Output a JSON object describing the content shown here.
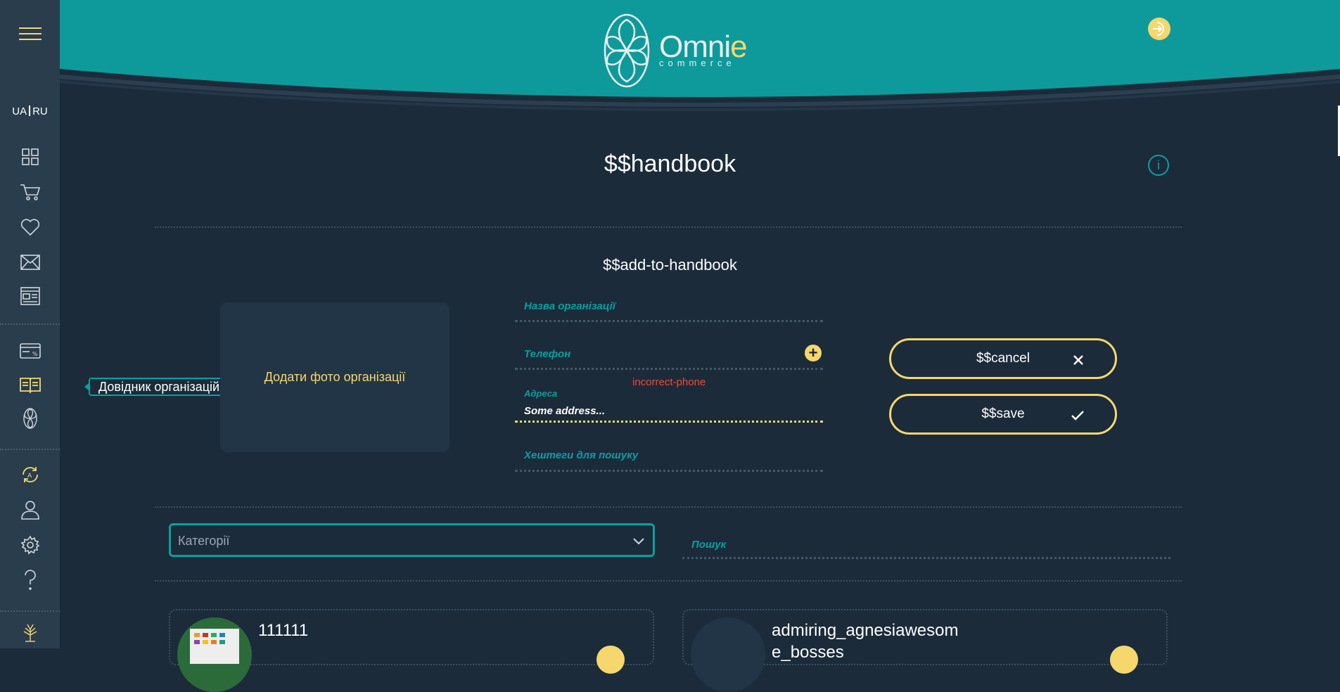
{
  "sidebar": {
    "lang_ua": "UA",
    "lang_ru": "RU",
    "tooltip": "Довідник організацій",
    "icons": [
      "menu-icon",
      "dashboard-icon",
      "cart-icon",
      "heart-icon",
      "mail-icon",
      "news-icon",
      "payment-card-icon",
      "handbook-icon",
      "omnie-flower-icon",
      "sync-icon",
      "user-icon",
      "settings-icon",
      "help-icon",
      "tree-icon"
    ]
  },
  "header": {
    "logo_text_main": "Omni",
    "logo_text_accent": "e",
    "logo_sub": "commerce"
  },
  "page": {
    "title": "$$handbook",
    "info_icon": "i",
    "section_title": "$$add-to-handbook"
  },
  "form": {
    "photo_label": "Додати фото організації",
    "org_name_placeholder": "Назва організації",
    "phone_placeholder": "Телефон",
    "phone_error": "incorrect-phone",
    "address_label": "Адреса",
    "address_value": "Some address...",
    "hashtags_placeholder": "Хештеги для пошуку",
    "cancel_label": "$$cancel",
    "save_label": "$$save"
  },
  "filters": {
    "category_placeholder": "Категорії",
    "search_placeholder": "Пошук"
  },
  "cards": [
    {
      "name": "111111",
      "sub": ""
    },
    {
      "name": "admiring_agnesiawesom",
      "sub": "e_bosses"
    }
  ],
  "colors": {
    "teal": "#0aa0a0",
    "accent": "#f5d76e",
    "background": "#1b2b3a",
    "sidebar": "#2a3d4d",
    "error": "#e74c3c"
  }
}
